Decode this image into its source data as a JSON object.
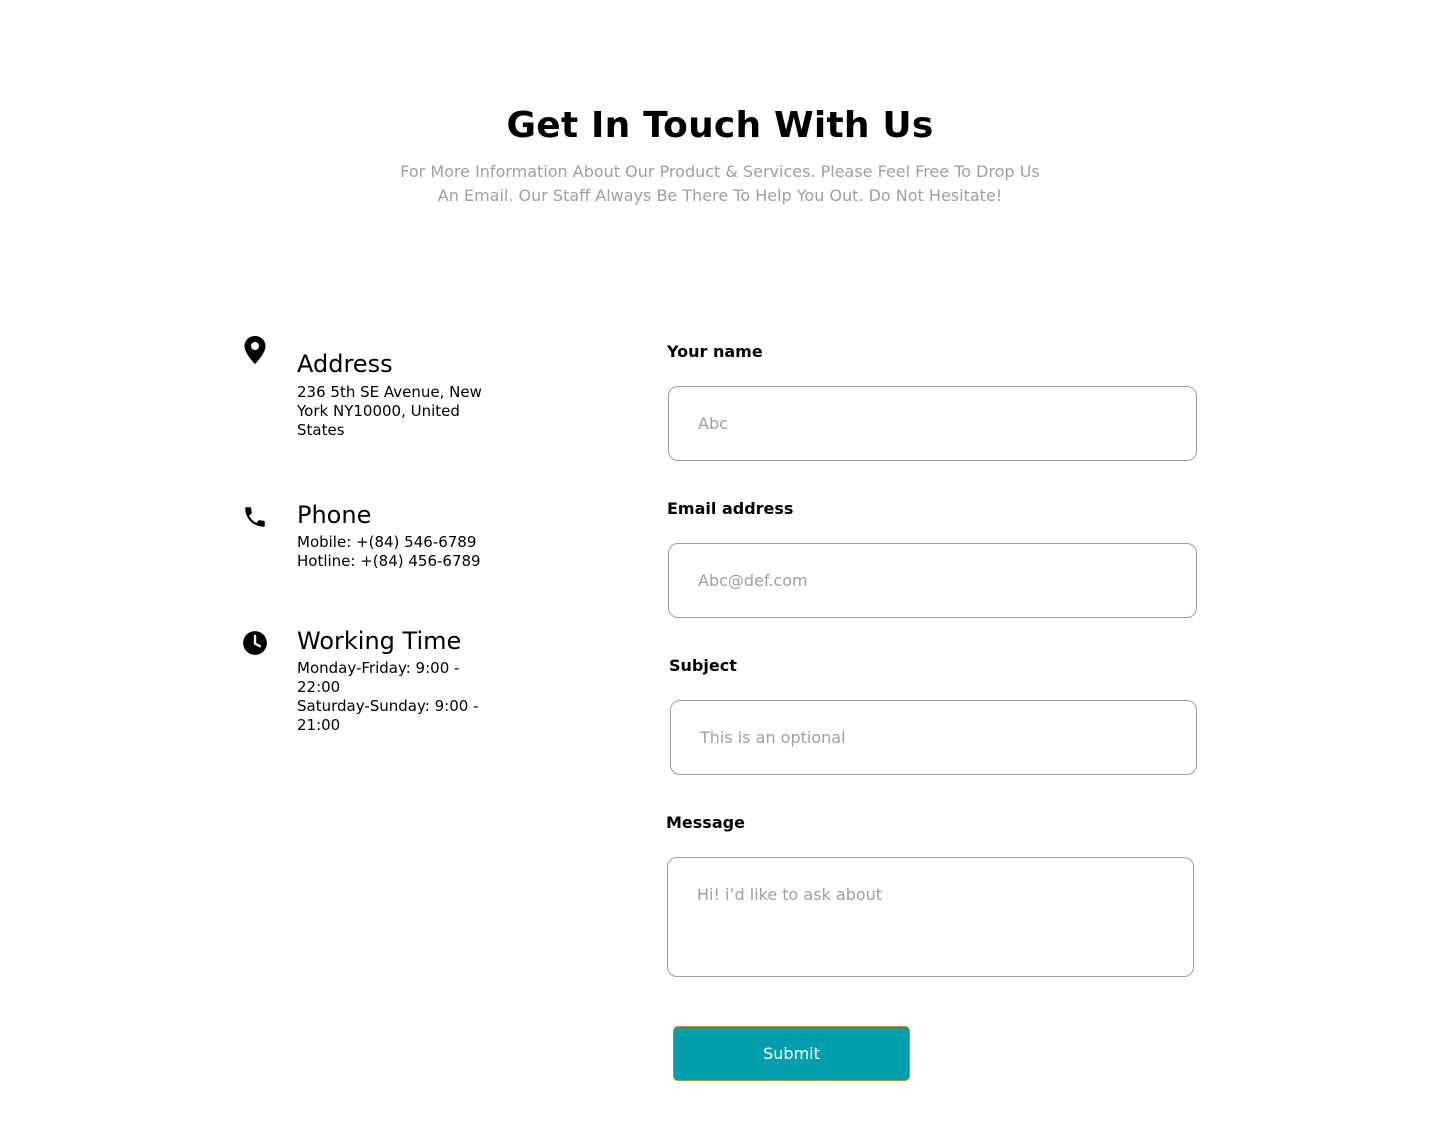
{
  "header": {
    "title": "Get In Touch With Us",
    "subtitle": "For More Information About Our Product & Services. Please Feel Free To Drop Us An Email. Our Staff Always Be There To Help You Out. Do Not Hesitate!"
  },
  "contact_info": {
    "address": {
      "icon": "location-pin-icon",
      "title": "Address",
      "lines": [
        "236 5th SE Avenue, New York NY10000, United States"
      ]
    },
    "phone": {
      "icon": "phone-icon",
      "title": "Phone",
      "lines": [
        "Mobile: +(84) 546-6789",
        "Hotline: +(84) 456-6789"
      ]
    },
    "working_time": {
      "icon": "clock-icon",
      "title": "Working Time",
      "lines": [
        "Monday-Friday: 9:00 - 22:00",
        "Saturday-Sunday: 9:00 - 21:00"
      ]
    }
  },
  "form": {
    "name": {
      "label": "Your name",
      "placeholder": "Abc",
      "value": ""
    },
    "email": {
      "label": "Email address",
      "placeholder": "Abc@def.com",
      "value": ""
    },
    "subject": {
      "label": "Subject",
      "placeholder": "This is an optional",
      "value": ""
    },
    "message": {
      "label": "Message",
      "placeholder": "Hi! i’d like to ask about",
      "value": ""
    },
    "submit_label": "Submit"
  },
  "colors": {
    "accent": "#009fad",
    "button_border": "#b88e2f",
    "muted_text": "#9f9f9f",
    "input_border": "#9f9f9f"
  }
}
